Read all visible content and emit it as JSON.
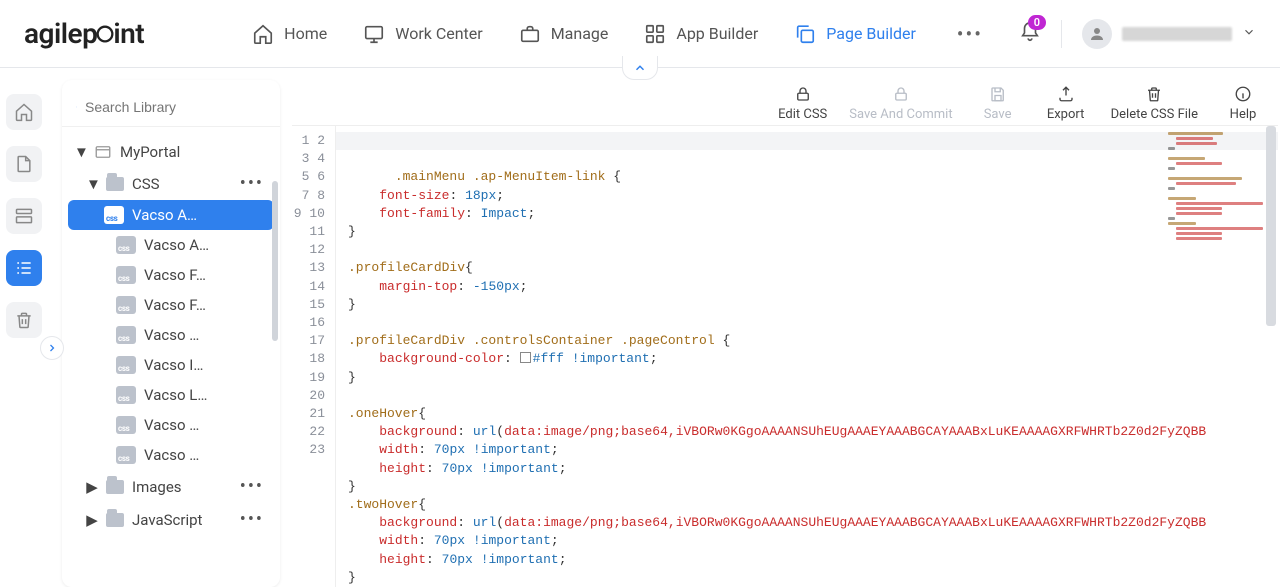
{
  "nav": {
    "logo": "agilepoint",
    "items": [
      {
        "label": "Home"
      },
      {
        "label": "Work Center"
      },
      {
        "label": "Manage"
      },
      {
        "label": "App Builder"
      },
      {
        "label": "Page Builder"
      }
    ],
    "badge": "0"
  },
  "library": {
    "search_placeholder": "Search Library",
    "root": {
      "label": "MyPortal"
    },
    "css_folder": {
      "label": "CSS"
    },
    "files": [
      {
        "label": "Vacso A…"
      },
      {
        "label": "Vacso A…"
      },
      {
        "label": "Vacso F…"
      },
      {
        "label": "Vacso F…"
      },
      {
        "label": "Vacso …"
      },
      {
        "label": "Vacso I…"
      },
      {
        "label": "Vacso L…"
      },
      {
        "label": "Vacso …"
      },
      {
        "label": "Vacso …"
      }
    ],
    "images_folder": {
      "label": "Images"
    },
    "js_folder": {
      "label": "JavaScript"
    },
    "css_badge": "css"
  },
  "toolbar": {
    "edit_css": "Edit CSS",
    "save_commit": "Save And Commit",
    "save": "Save",
    "export": "Export",
    "delete": "Delete CSS File",
    "help": "Help"
  },
  "code": {
    "lines": 23,
    "l1_sel": ".mainMenu .ap-MenuItem-link",
    "l2_prop": "font-size",
    "l2_val": "18px",
    "l3_prop": "font-family",
    "l3_val": "Impact",
    "l6_sel": ".profileCardDiv",
    "l7_prop": "margin-top",
    "l7_val": "-150px",
    "l10_sel": ".profileCardDiv .controlsContainer .pageControl",
    "l11_prop": "background-color",
    "l11_val": "#fff",
    "l11_imp": "!important",
    "l14_sel": ".oneHover",
    "l15_prop": "background",
    "l15_func": "url",
    "l15_arg": "data:image/png;base64,iVBORw0KGgoAAAANSUhEUgAAAEYAAABGCAYAAABxLuKEAAAAGXRFWHRTb2Z0d2FyZQBB",
    "l16_prop": "width",
    "l16_val": "70px",
    "l16_imp": "!important",
    "l17_prop": "height",
    "l17_val": "70px",
    "l17_imp": "!important",
    "l19_sel": ".twoHover",
    "l20_prop": "background",
    "l20_func": "url",
    "l20_arg": "data:image/png;base64,iVBORw0KGgoAAAANSUhEUgAAAEYAAABGCAYAAABxLuKEAAAAGXRFWHRTb2Z0d2FyZQBB",
    "l21_prop": "width",
    "l21_val": "70px",
    "l21_imp": "!important",
    "l22_prop": "height",
    "l22_val": "70px",
    "l22_imp": "!important"
  }
}
